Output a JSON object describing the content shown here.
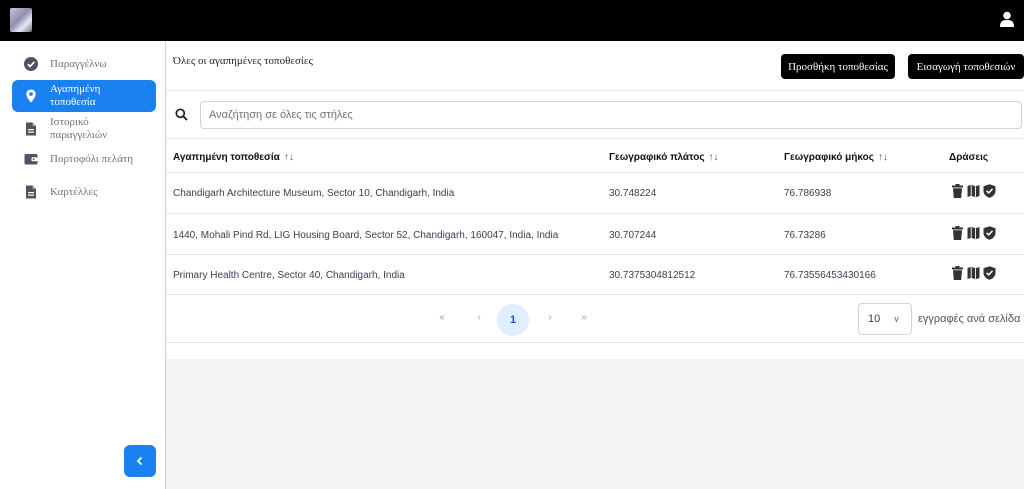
{
  "sidebar": {
    "items": [
      {
        "label_lines": [
          "Παραγγέλνω"
        ]
      },
      {
        "label_lines": [
          "Αγαπημένη",
          "τοποθεσία"
        ]
      },
      {
        "label_lines": [
          "Ιστορικό",
          "παραγγελιών"
        ]
      },
      {
        "label_lines": [
          "Πορτοφόλι πελάτη"
        ]
      },
      {
        "label_lines": [
          "Καρτέλλες"
        ]
      }
    ]
  },
  "main": {
    "title": "Όλες οι αγαπημένες τοποθεσίες",
    "add_button": "Προσθήκη τοποθεσίας",
    "import_button": "Εισαγωγή τοποθεσιών",
    "search_placeholder": "Αναζήτηση σε όλες τις στήλες"
  },
  "table": {
    "columns": [
      "Αγαπημένη τοποθεσία",
      "Γεωγραφικό πλάτος",
      "Γεωγραφικό μήκος",
      "Δράσεις"
    ],
    "sort_symbol": "↑↓",
    "rows": [
      {
        "location": "Chandigarh Architecture Museum, Sector 10, Chandigarh, India",
        "latitude": "30.748224",
        "longitude": "76.786938"
      },
      {
        "location": "1440, Mohali Pind Rd, LIG Housing Board, Sector 52, Chandigarh, 160047, India, India",
        "latitude": "30.707244",
        "longitude": "76.73286"
      },
      {
        "location": "Primary Health Centre, Sector 40, Chandigarh, India",
        "latitude": "30.7375304812512",
        "longitude": "76.73556453430166"
      }
    ]
  },
  "pagination": {
    "first": "«",
    "prev": "‹",
    "current": "1",
    "next": "›",
    "last": "»",
    "page_size": "10",
    "page_size_chevron": "∨",
    "per_page_label": "εγγραφές ανά σελίδα"
  },
  "colors": {
    "accent": "#1a82f0",
    "topbar": "#000000",
    "active_page_bg": "#e0efff"
  },
  "icons": {
    "sidebar": [
      "check-circle-icon",
      "map-pin-icon",
      "file-icon",
      "wallet-icon",
      "file-icon"
    ],
    "row_actions": [
      "trash-icon",
      "map-icon",
      "shield-check-icon"
    ],
    "topbar": [
      "logo",
      "user-icon"
    ],
    "collapse": "chevron-left-icon",
    "search": "search-icon"
  }
}
